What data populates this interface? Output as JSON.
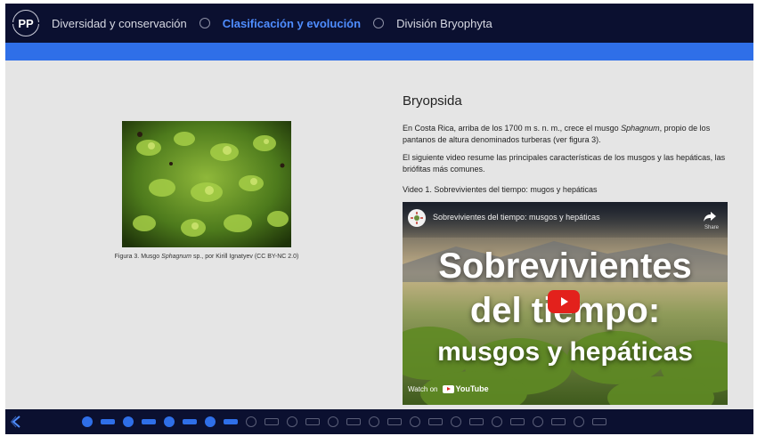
{
  "header": {
    "logo_text": "PP",
    "breadcrumbs": [
      "Diversidad y conservación",
      "Clasificación y evolución",
      "División Bryophyta"
    ],
    "active_index": 1
  },
  "figure": {
    "caption_prefix": "Figura 3. Musgo ",
    "caption_italic": "Sphagnum",
    "caption_suffix": " sp., por Kirill Ignatyev (CC BY-NC 2.0)"
  },
  "content": {
    "heading": "Bryopsida",
    "p1_before": "En Costa Rica, arriba de los 1700 m s. n. m., crece el musgo ",
    "p1_italic": "Sphagnum",
    "p1_after": ", propio de los pantanos de altura denominados turberas (ver figura 3).",
    "p2": "El siguiente video resume las principales características de los musgos y las hepáticas, las briófitas más comunes.",
    "video_label": "Video 1. Sobrevivientes del tiempo: mugos y hepáticas"
  },
  "video": {
    "title": "Sobrevivientes del tiempo: musgos y hepáticas",
    "share_label": "Share",
    "line1": "Sobrevivientes",
    "line2": "del tiempo:",
    "line3": "musgos y hepáticas",
    "watch_on": "Watch on",
    "youtube": "YouTube"
  },
  "progress": {
    "items": [
      "dot",
      "dash",
      "dot",
      "dash",
      "dot",
      "dash",
      "dot",
      "dash",
      "dot",
      "dash",
      "dot",
      "dash",
      "dot",
      "dash",
      "dot",
      "dash",
      "dot",
      "dash",
      "dot",
      "dash",
      "dot",
      "dash",
      "dot",
      "dash",
      "dot",
      "dash"
    ],
    "completed": 8
  },
  "colors": {
    "nav_bg": "#0b1030",
    "accent": "#2f6fe8",
    "active_crumb": "#4f8dff",
    "youtube_red": "#e3211c"
  }
}
